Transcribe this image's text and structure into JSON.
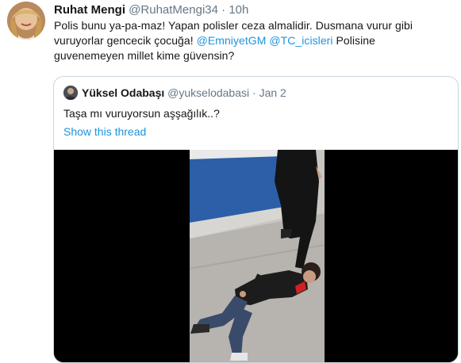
{
  "tweet": {
    "name": "Ruhat Mengi",
    "handle": "@RuhatMengi34",
    "separator": "·",
    "time": "10h",
    "line1": "Polis bunu ya-pa-maz! Yapan polisler ceza almalidir. Dusmana vurur gibi",
    "line2_text": "vuruyorlar gencecik çocuğa! ",
    "mention1": "@EmniyetGM",
    "mention2": "@TC_icisleri",
    "line2_tail": " Polisine",
    "line3": "guvenemeyen millet kime güvensin?"
  },
  "quoted": {
    "name": "Yüksel Odabaşı",
    "handle": "@yukselodabasi",
    "separator": "·",
    "time": "Jan 2",
    "text": "Taşa mı vuruyorsun aşşağılık..?",
    "show_thread": "Show this thread"
  },
  "colors": {
    "link": "#1b95e0",
    "secondary": "#657786",
    "border": "#ccd6dd"
  },
  "icons": {
    "author_avatar": "avatar-photo",
    "quoted_avatar": "avatar-photo"
  }
}
